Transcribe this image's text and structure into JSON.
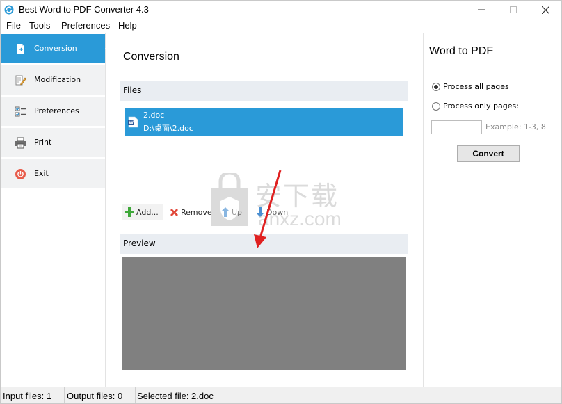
{
  "window": {
    "title": "Best Word to PDF Converter 4.3",
    "controls": {
      "minimize": "—",
      "maximize": "☐",
      "close": "✕"
    }
  },
  "menu": [
    "File",
    "Tools",
    "Preferences",
    "Help"
  ],
  "sidebar": {
    "items": [
      {
        "label": "Conversion",
        "icon": "conversion-icon",
        "active": true
      },
      {
        "label": "Modification",
        "icon": "edit-icon",
        "active": false
      },
      {
        "label": "Preferences",
        "icon": "checklist-icon",
        "active": false
      },
      {
        "label": "Print",
        "icon": "printer-icon",
        "active": false
      },
      {
        "label": "Exit",
        "icon": "power-icon",
        "active": false
      }
    ]
  },
  "main": {
    "title": "Conversion",
    "files_header": "Files",
    "files": [
      {
        "name": "2.doc",
        "path": "D:\\桌面\\2.doc"
      }
    ],
    "toolbar": {
      "add": "Add...",
      "remove": "Remove",
      "up": "Up",
      "down": "Down"
    },
    "preview_header": "Preview"
  },
  "watermark": {
    "text_cn": "安下载",
    "text_en": "anxz.com"
  },
  "right_panel": {
    "title": "Word to PDF",
    "option_all": "Process all pages",
    "option_only": "Process only pages:",
    "selected_option": "all",
    "pages_value": "",
    "pages_hint": "Example: 1-3, 8",
    "convert_label": "Convert"
  },
  "status": {
    "input": "Input files: 1",
    "output": "Output files: 0",
    "selected": "Selected file: 2.doc"
  },
  "colors": {
    "accent": "#2a9ad8",
    "nav_bg": "#f1f2f3",
    "header_bg": "#e9edf2",
    "preview_bg": "#808080",
    "arrow": "#e02020"
  }
}
